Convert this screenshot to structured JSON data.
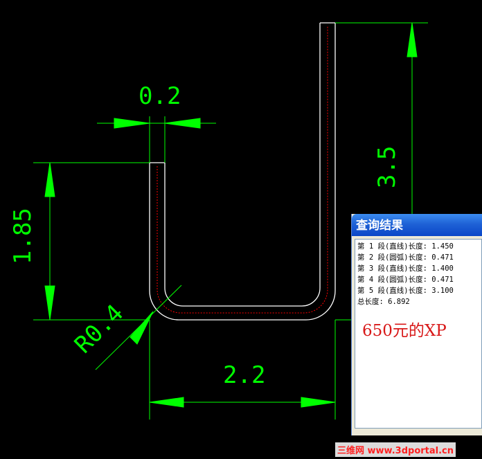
{
  "drawing": {
    "colors": {
      "background": "#000000",
      "dimension": "#00ff00",
      "outline": "#ffffff",
      "centerline": "#ff0000"
    },
    "dimensions": {
      "thickness": "0.2",
      "left_height": "1.85",
      "right_height": "3.5",
      "bottom_width": "2.2",
      "radius": "R0.4"
    }
  },
  "query_window": {
    "title": "查询结果",
    "results": [
      "第 1 段(直线)长度: 1.450",
      "第 2 段(圆弧)长度: 0.471",
      "第 3 段(直线)长度: 1.400",
      "第 4 段(圆弧)长度: 0.471",
      "第 5 段(直线)长度: 3.100",
      "总长度: 6.892"
    ],
    "annotation": "650元的XP"
  },
  "watermark": "三维网 www.3dportal.cn"
}
